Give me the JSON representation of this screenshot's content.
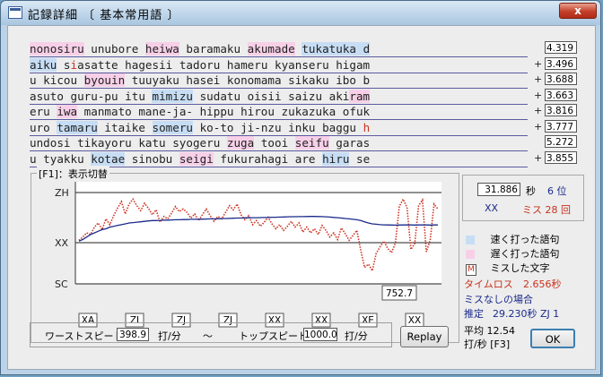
{
  "window": {
    "title": "記録詳細 〔 基本常用語 〕",
    "close_label": "x"
  },
  "text_lines": [
    {
      "prefix": "",
      "score": "4.319",
      "segments": [
        {
          "t": "nonosiru",
          "k": "slow"
        },
        {
          "t": " unubore ",
          "k": ""
        },
        {
          "t": "heiwa",
          "k": "slow"
        },
        {
          "t": " baramaku ",
          "k": ""
        },
        {
          "t": "akumade",
          "k": "slow"
        },
        {
          "t": " ",
          "k": ""
        },
        {
          "t": "tukatuka d",
          "k": "fast"
        }
      ]
    },
    {
      "prefix": "+",
      "score": "3.496",
      "segments": [
        {
          "t": "aiku",
          "k": "fast"
        },
        {
          "t": " s",
          "k": ""
        },
        {
          "t": "i",
          "k": "miss"
        },
        {
          "t": "asatte hagesii tadoru hameru kyanseru higam",
          "k": ""
        }
      ]
    },
    {
      "prefix": "+",
      "score": "3.688",
      "segments": [
        {
          "t": "u kicou ",
          "k": ""
        },
        {
          "t": "byouin",
          "k": "slow"
        },
        {
          "t": " tuuyaku hasei konomama sikaku ibo b",
          "k": ""
        }
      ]
    },
    {
      "prefix": "+",
      "score": "3.663",
      "segments": [
        {
          "t": "asuto guru-pu itu ",
          "k": ""
        },
        {
          "t": "mimizu",
          "k": "fast"
        },
        {
          "t": " sudatu oisii saizu aki",
          "k": ""
        },
        {
          "t": "ram",
          "k": "slow"
        }
      ]
    },
    {
      "prefix": "+",
      "score": "3.816",
      "segments": [
        {
          "t": "eru ",
          "k": ""
        },
        {
          "t": "iwa",
          "k": "slow"
        },
        {
          "t": " manmato mane-ja- hippu hirou zukazuka ofuk",
          "k": ""
        }
      ]
    },
    {
      "prefix": "+",
      "score": "3.777",
      "segments": [
        {
          "t": "uro ",
          "k": ""
        },
        {
          "t": "tamaru",
          "k": "fast"
        },
        {
          "t": " itaike ",
          "k": ""
        },
        {
          "t": "someru",
          "k": "fast"
        },
        {
          "t": " ko-to ji-nzu inku baggu ",
          "k": ""
        },
        {
          "t": "h",
          "k": "miss"
        }
      ]
    },
    {
      "prefix": "",
      "score": "5.272",
      "segments": [
        {
          "t": "undosi tikayoru katu syogeru ",
          "k": ""
        },
        {
          "t": "zuga",
          "k": "slow"
        },
        {
          "t": " tooi ",
          "k": ""
        },
        {
          "t": "seifu",
          "k": "slow"
        },
        {
          "t": " garas",
          "k": ""
        }
      ]
    },
    {
      "prefix": "+",
      "score": "3.855",
      "segments": [
        {
          "t": "u tyakku ",
          "k": ""
        },
        {
          "t": "kotae",
          "k": "fast"
        },
        {
          "t": " sinobu ",
          "k": ""
        },
        {
          "t": "seigi",
          "k": "slow"
        },
        {
          "t": " fukurahagi are ",
          "k": ""
        },
        {
          "t": "hiru",
          "k": "fast"
        },
        {
          "t": " se",
          "k": ""
        }
      ]
    }
  ],
  "chart_group_label": "[F1]：表示切替",
  "chart_data": {
    "type": "line",
    "y_ticks": [
      "ZH",
      "XX",
      "SC"
    ],
    "x_rank_labels": [
      "XA",
      "ZI",
      "ZJ",
      "ZJ",
      "XX",
      "XX",
      "XE",
      "XX"
    ],
    "readout": "752.7",
    "ylim": [
      0,
      10
    ],
    "series": [
      {
        "name": "",
        "color": "#cc3322",
        "style": "dotted",
        "values": [
          4.2,
          4.6,
          5.1,
          4.9,
          5.8,
          6.3,
          5.5,
          6.8,
          6.1,
          7.2,
          8.1,
          8.9,
          7.4,
          8.6,
          9.2,
          8.4,
          7.8,
          8.7,
          8.1,
          7.3,
          7.9,
          6.4,
          7.1,
          6.8,
          7.5,
          8.3,
          7.7,
          8.0,
          7.6,
          6.9,
          7.4,
          6.6,
          7.3,
          8.0,
          7.2,
          6.5,
          7.1,
          6.8,
          7.6,
          8.4,
          7.9,
          8.6,
          7.3,
          6.7,
          7.2,
          6.1,
          6.6,
          5.9,
          6.4,
          7.0,
          6.2,
          5.6,
          6.1,
          5.4,
          5.9,
          6.5,
          5.8,
          6.3,
          5.2,
          5.8,
          5.1,
          5.6,
          4.9,
          6.0,
          5.4,
          4.6,
          5.1,
          4.3,
          5.7,
          5.0,
          4.2,
          4.8,
          5.4,
          3.0,
          0.9,
          1.3,
          0.5,
          2.6,
          3.4,
          4.1,
          3.2,
          2.7,
          3.9,
          8.3,
          9.2,
          8.2,
          3.1,
          3.8,
          8.4,
          9.1,
          2.8,
          4.2,
          8.6,
          8.0
        ]
      },
      {
        "name": "",
        "color": "#1a2a8a",
        "style": "solid",
        "values": [
          4.1,
          4.3,
          4.6,
          4.9,
          5.1,
          5.3,
          5.5,
          5.6,
          5.8,
          5.9,
          6.0,
          6.1,
          6.2,
          6.3,
          6.35,
          6.4,
          6.45,
          6.5,
          6.55,
          6.6,
          6.6,
          6.62,
          6.65,
          6.65,
          6.67,
          6.7,
          6.7,
          6.72,
          6.72,
          6.75,
          6.75,
          6.76,
          6.77,
          6.78,
          6.8,
          6.8,
          6.82,
          6.84,
          6.85,
          6.86,
          6.88,
          6.9,
          6.9,
          6.92,
          6.93,
          6.95,
          6.95,
          6.96,
          6.97,
          6.98,
          7.0,
          7.0,
          7.02,
          7.03,
          7.05,
          7.06,
          7.07,
          7.08,
          7.08,
          7.09,
          7.1,
          7.1,
          7.09,
          7.08,
          7.05,
          7.02,
          6.98,
          6.95,
          6.9,
          6.85,
          6.8,
          6.75,
          6.7,
          6.6,
          6.45,
          6.3,
          6.2,
          6.15,
          6.1,
          6.08,
          6.06,
          6.05,
          6.04,
          6.05,
          6.07,
          6.08,
          6.06,
          6.05,
          6.06,
          6.08,
          6.06,
          6.05,
          6.06,
          6.07
        ]
      }
    ]
  },
  "stats": {
    "time": "31.886",
    "time_unit": "秒",
    "rank_position": "6 位",
    "rank": "XX",
    "miss_label": "ミス",
    "miss_count": "28",
    "miss_unit": "回"
  },
  "legend": {
    "fast_label": "速く打った語句",
    "slow_label": "遅く打った語句",
    "miss_marker": "M",
    "miss_label": "ミスした文字",
    "fast_color": "#c6ddf4",
    "slow_color": "#f7d0e8",
    "miss_color": "#c8321e"
  },
  "time_loss": {
    "label": "タイムロス",
    "value": "2.656秒"
  },
  "no_miss": {
    "label": "ミスなしの場合",
    "estimate_label": "推定",
    "estimate_value": "29.230秒 ZJ  1"
  },
  "average": {
    "line1": "平均 12.54",
    "line2": "打/秒 [F3]"
  },
  "speed": {
    "worst_label": "ワーストスピード",
    "worst_value": "398.9",
    "unit1": "打/分",
    "tilde": "～",
    "top_label": "トップスピード",
    "top_value": "1000.0",
    "unit2": "打/分"
  },
  "buttons": {
    "replay": "Replay",
    "ok": "OK"
  }
}
